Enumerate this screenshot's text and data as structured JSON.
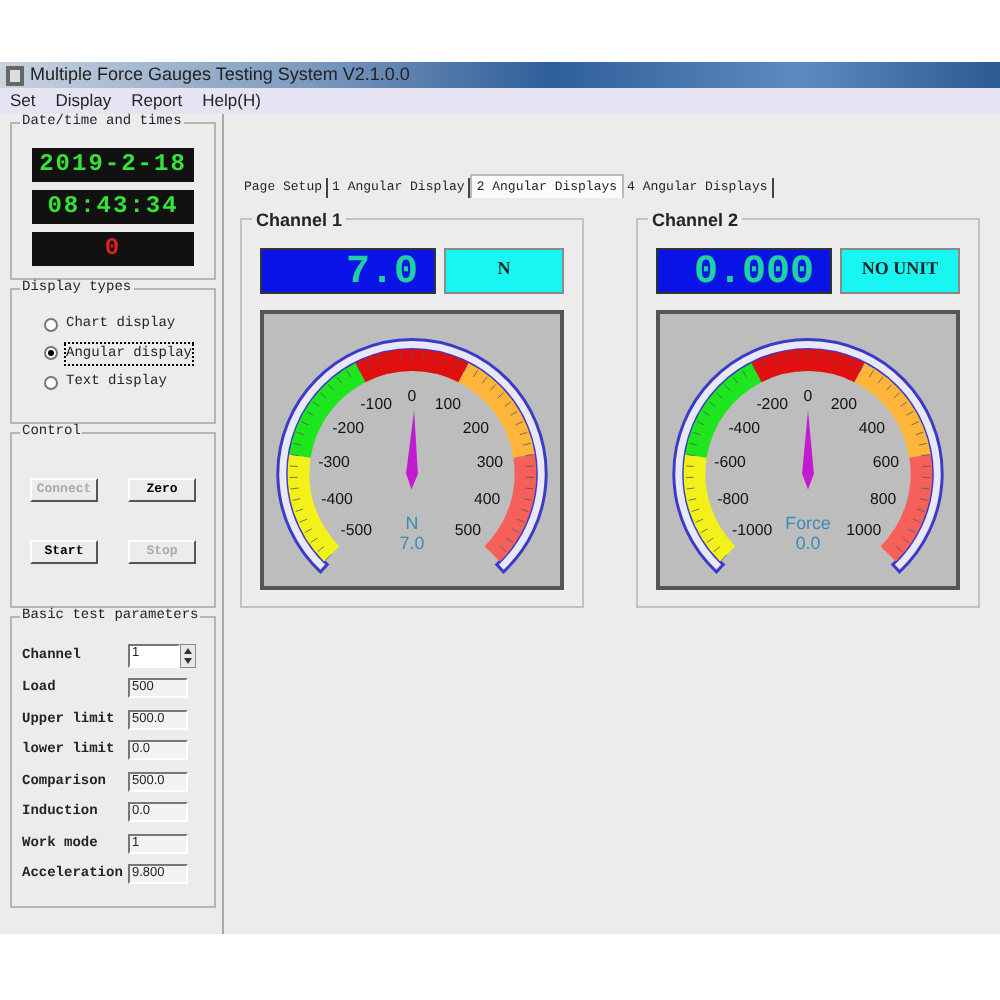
{
  "window": {
    "title": "Multiple Force Gauges Testing System V2.1.0.0"
  },
  "menu": [
    "Set",
    "Display",
    "Report",
    "Help(H)"
  ],
  "datetime": {
    "title": "Date/time and times",
    "date": "2019-2-18",
    "time": "08:43:34",
    "count": "0"
  },
  "display_types": {
    "title": "Display types",
    "options": [
      {
        "label": "Chart display",
        "selected": false
      },
      {
        "label": "Angular display",
        "selected": true
      },
      {
        "label": "Text display",
        "selected": false
      }
    ]
  },
  "control": {
    "title": "Control",
    "buttons": [
      {
        "label": "Connect",
        "disabled": true
      },
      {
        "label": "Zero",
        "disabled": false
      },
      {
        "label": "Start",
        "disabled": false
      },
      {
        "label": "Stop",
        "disabled": true
      }
    ]
  },
  "parameters": {
    "title": "Basic test parameters",
    "fields": [
      {
        "label": "Channel",
        "value": "1",
        "kind": "spin"
      },
      {
        "label": "Load",
        "value": "500",
        "kind": "text"
      },
      {
        "label": "Upper limit",
        "value": "500.0",
        "kind": "text"
      },
      {
        "label": "lower limit",
        "value": "0.0",
        "kind": "text"
      },
      {
        "label": "Comparison",
        "value": "500.0",
        "kind": "text"
      },
      {
        "label": "Induction",
        "value": "0.0",
        "kind": "text"
      },
      {
        "label": "Work mode",
        "value": "1",
        "kind": "text"
      },
      {
        "label": "Acceleration",
        "value": "9.800",
        "kind": "text"
      }
    ]
  },
  "tabs": [
    {
      "label": "Page Setup",
      "selected": false
    },
    {
      "label": "1 Angular Display",
      "selected": false
    },
    {
      "label": "2 Angular Displays",
      "selected": true
    },
    {
      "label": "4 Angular Displays",
      "selected": false
    }
  ],
  "channels": [
    {
      "title": "Channel 1",
      "reading": "7.0",
      "unit": "N",
      "scale": [
        "-500",
        "-400",
        "-300",
        "-200",
        "-100",
        "0",
        "100",
        "200",
        "300",
        "400",
        "500"
      ],
      "dial_unit": "N",
      "dial_value": "7.0",
      "level": 0.507
    },
    {
      "title": "Channel 2",
      "reading": "0.000",
      "unit": "NO UNIT",
      "scale": [
        "-1000",
        "-800",
        "-600",
        "-400",
        "-200",
        "0",
        "200",
        "400",
        "600",
        "800",
        "1000"
      ],
      "dial_unit": "Force",
      "dial_value": "0.0",
      "level": 0.5
    }
  ]
}
